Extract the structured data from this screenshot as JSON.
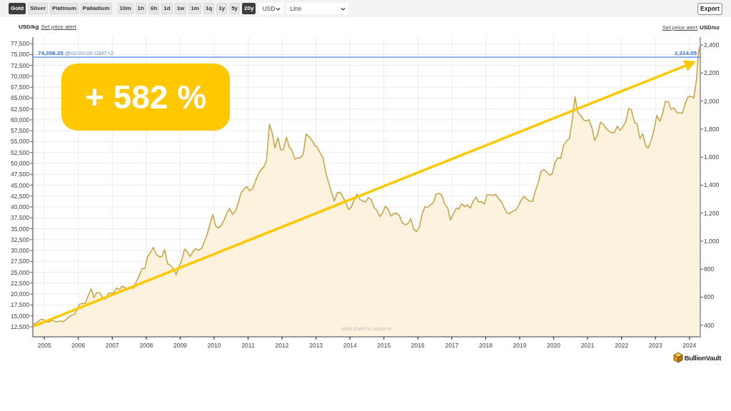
{
  "toolbar": {
    "metals": [
      {
        "label": "Gold",
        "selected": true
      },
      {
        "label": "Silver",
        "selected": false
      },
      {
        "label": "Platinum",
        "selected": false
      },
      {
        "label": "Palladium",
        "selected": false
      }
    ],
    "ranges": [
      {
        "label": "10m",
        "selected": false
      },
      {
        "label": "1h",
        "selected": false
      },
      {
        "label": "6h",
        "selected": false
      },
      {
        "label": "1d",
        "selected": false
      },
      {
        "label": "1w",
        "selected": false
      },
      {
        "label": "1m",
        "selected": false
      },
      {
        "label": "1q",
        "selected": false
      },
      {
        "label": "1y",
        "selected": false
      },
      {
        "label": "5y",
        "selected": false
      },
      {
        "label": "20y",
        "selected": true
      }
    ],
    "currency_select": {
      "value": "USD"
    },
    "chart_type_select": {
      "value": "Line"
    },
    "export_button": "Export"
  },
  "chart": {
    "left_axis": {
      "unit": "USD/kg",
      "link": "Set price alert",
      "ticks": [
        "77,500",
        "75,000",
        "72,500",
        "70,000",
        "67,500",
        "65,000",
        "62,500",
        "60,000",
        "57,500",
        "55,000",
        "52,500",
        "50,000",
        "47,500",
        "45,000",
        "42,500",
        "40,000",
        "37,500",
        "35,000",
        "32,500",
        "30,000",
        "27,500",
        "25,000",
        "22,500",
        "20,000",
        "17,500",
        "15,000",
        "12,500"
      ]
    },
    "right_axis": {
      "link": "Set price alert"
    },
    "price_marker": {
      "label": "74,398.35",
      "time": "@02:00:00 GMT+2"
    },
    "overlays": [
      {
        "kind": "trend_arrow"
      },
      {
        "kind": "badge",
        "text": "+ 582 %"
      }
    ],
    "hint": "click chart to zoom in",
    "chart_data": {
      "type": "area",
      "ylabel": "USD/oz",
      "grid": true,
      "x": [
        2004.66,
        2004.79,
        2004.88,
        2004.96,
        2005.04,
        2005.13,
        2005.21,
        2005.29,
        2005.38,
        2005.46,
        2005.54,
        2005.63,
        2005.71,
        2005.79,
        2005.88,
        2005.96,
        2006.04,
        2006.13,
        2006.21,
        2006.29,
        2006.38,
        2006.46,
        2006.54,
        2006.63,
        2006.71,
        2006.79,
        2006.88,
        2006.96,
        2007.04,
        2007.13,
        2007.21,
        2007.29,
        2007.38,
        2007.46,
        2007.54,
        2007.63,
        2007.71,
        2007.79,
        2007.88,
        2007.96,
        2008.04,
        2008.13,
        2008.21,
        2008.29,
        2008.38,
        2008.46,
        2008.54,
        2008.63,
        2008.71,
        2008.79,
        2008.88,
        2008.96,
        2009.04,
        2009.13,
        2009.21,
        2009.29,
        2009.38,
        2009.46,
        2009.54,
        2009.63,
        2009.71,
        2009.79,
        2009.88,
        2009.96,
        2010.04,
        2010.13,
        2010.21,
        2010.29,
        2010.38,
        2010.46,
        2010.54,
        2010.63,
        2010.71,
        2010.79,
        2010.88,
        2010.96,
        2011.04,
        2011.13,
        2011.21,
        2011.29,
        2011.38,
        2011.46,
        2011.54,
        2011.63,
        2011.71,
        2011.79,
        2011.88,
        2011.96,
        2012.04,
        2012.13,
        2012.21,
        2012.29,
        2012.38,
        2012.46,
        2012.54,
        2012.63,
        2012.71,
        2012.79,
        2012.88,
        2012.96,
        2013.04,
        2013.13,
        2013.21,
        2013.29,
        2013.38,
        2013.46,
        2013.54,
        2013.63,
        2013.71,
        2013.79,
        2013.88,
        2013.96,
        2014.04,
        2014.13,
        2014.21,
        2014.29,
        2014.38,
        2014.46,
        2014.54,
        2014.63,
        2014.71,
        2014.79,
        2014.88,
        2014.96,
        2015.04,
        2015.13,
        2015.21,
        2015.29,
        2015.38,
        2015.46,
        2015.54,
        2015.63,
        2015.71,
        2015.79,
        2015.88,
        2015.96,
        2016.04,
        2016.13,
        2016.21,
        2016.29,
        2016.38,
        2016.46,
        2016.54,
        2016.63,
        2016.71,
        2016.79,
        2016.88,
        2016.96,
        2017.04,
        2017.13,
        2017.21,
        2017.29,
        2017.38,
        2017.46,
        2017.54,
        2017.63,
        2017.71,
        2017.79,
        2017.88,
        2017.96,
        2018.04,
        2018.13,
        2018.21,
        2018.29,
        2018.38,
        2018.46,
        2018.54,
        2018.63,
        2018.71,
        2018.79,
        2018.88,
        2018.96,
        2019.04,
        2019.13,
        2019.21,
        2019.29,
        2019.38,
        2019.46,
        2019.54,
        2019.63,
        2019.71,
        2019.79,
        2019.88,
        2019.96,
        2020.04,
        2020.13,
        2020.21,
        2020.29,
        2020.38,
        2020.46,
        2020.54,
        2020.63,
        2020.71,
        2020.79,
        2020.88,
        2020.96,
        2021.04,
        2021.13,
        2021.21,
        2021.29,
        2021.38,
        2021.46,
        2021.54,
        2021.63,
        2021.71,
        2021.79,
        2021.88,
        2021.96,
        2022.04,
        2022.13,
        2022.21,
        2022.29,
        2022.38,
        2022.46,
        2022.54,
        2022.63,
        2022.71,
        2022.79,
        2022.88,
        2022.96,
        2023.04,
        2023.13,
        2023.21,
        2023.29,
        2023.38,
        2023.46,
        2023.54,
        2023.63,
        2023.71,
        2023.79,
        2023.88,
        2023.96,
        2024.04,
        2024.13,
        2024.21,
        2024.26,
        2024.29,
        2024.32
      ],
      "series": [
        {
          "color": "#c8a64b",
          "values": [
            403,
            420,
            439,
            442,
            424,
            423,
            434,
            429,
            422,
            431,
            424,
            438,
            456,
            470,
            476,
            510,
            550,
            555,
            557,
            610,
            660,
            596,
            633,
            632,
            598,
            585,
            627,
            629,
            631,
            665,
            655,
            679,
            667,
            655,
            665,
            665,
            712,
            754,
            806,
            803,
            889,
            922,
            955,
            909,
            888,
            889,
            939,
            839,
            829,
            806,
            760,
            816,
            858,
            943,
            924,
            890,
            928,
            946,
            934,
            949,
            996,
            1043,
            1127,
            1190,
            1110,
            1095,
            1113,
            1148,
            1205,
            1233,
            1193,
            1215,
            1271,
            1343,
            1370,
            1391,
            1360,
            1374,
            1424,
            1473,
            1510,
            1529,
            1572,
            1835,
            1772,
            1666,
            1739,
            1652,
            1656,
            1743,
            1674,
            1650,
            1585,
            1596,
            1594,
            1626,
            1765,
            1747,
            1721,
            1685,
            1671,
            1627,
            1593,
            1487,
            1414,
            1343,
            1286,
            1347,
            1349,
            1316,
            1275,
            1225,
            1244,
            1300,
            1336,
            1299,
            1287,
            1279,
            1311,
            1296,
            1239,
            1222,
            1176,
            1200,
            1251,
            1227,
            1179,
            1198,
            1199,
            1181,
            1131,
            1117,
            1125,
            1159,
            1086,
            1068,
            1097,
            1199,
            1246,
            1242,
            1260,
            1276,
            1337,
            1341,
            1326,
            1266,
            1236,
            1151,
            1192,
            1234,
            1231,
            1266,
            1246,
            1260,
            1236,
            1283,
            1314,
            1280,
            1282,
            1265,
            1331,
            1331,
            1325,
            1335,
            1304,
            1281,
            1238,
            1201,
            1198,
            1215,
            1221,
            1250,
            1291,
            1320,
            1300,
            1285,
            1284,
            1359,
            1413,
            1500,
            1510,
            1495,
            1471,
            1480,
            1560,
            1597,
            1591,
            1683,
            1715,
            1732,
            1846,
            2030,
            1921,
            1900,
            1866,
            1858,
            1867,
            1808,
            1718,
            1760,
            1850,
            1834,
            1807,
            1785,
            1775,
            1777,
            1821,
            1790,
            1817,
            1856,
            1948,
            1937,
            1849,
            1837,
            1733,
            1765,
            1681,
            1664,
            1726,
            1798,
            1898,
            1855,
            1912,
            1999,
            1992,
            1942,
            1951,
            1918,
            1916,
            1915,
            1985,
            2031,
            2034,
            2023,
            2160,
            2330,
            2385,
            2314
          ]
        }
      ],
      "xlim": [
        2004.66,
        2024.32
      ],
      "ylim": [
        317,
        2457
      ],
      "xticks": [
        2005,
        2006,
        2007,
        2008,
        2009,
        2010,
        2011,
        2012,
        2013,
        2014,
        2015,
        2016,
        2017,
        2018,
        2019,
        2020,
        2021,
        2022,
        2023,
        2024
      ],
      "yticks": [
        {
          "value": 400,
          "label": "400"
        },
        {
          "value": 600,
          "label": "600"
        },
        {
          "value": 800,
          "label": "800"
        },
        {
          "value": 1000,
          "label": "1,000"
        },
        {
          "value": 1200,
          "label": "1,200"
        },
        {
          "value": 1400,
          "label": "1,400"
        },
        {
          "value": 1600,
          "label": "1,600"
        },
        {
          "value": 1800,
          "label": "1,800"
        },
        {
          "value": 2000,
          "label": "2,000"
        },
        {
          "value": 2200,
          "label": "2,200"
        },
        {
          "value": 2400,
          "label": "2,400"
        }
      ],
      "ref_lines": [
        {
          "axis": "y",
          "value": 2314.05,
          "label": "2,314.05"
        }
      ]
    }
  },
  "logo": {
    "text": "BullionVault"
  }
}
